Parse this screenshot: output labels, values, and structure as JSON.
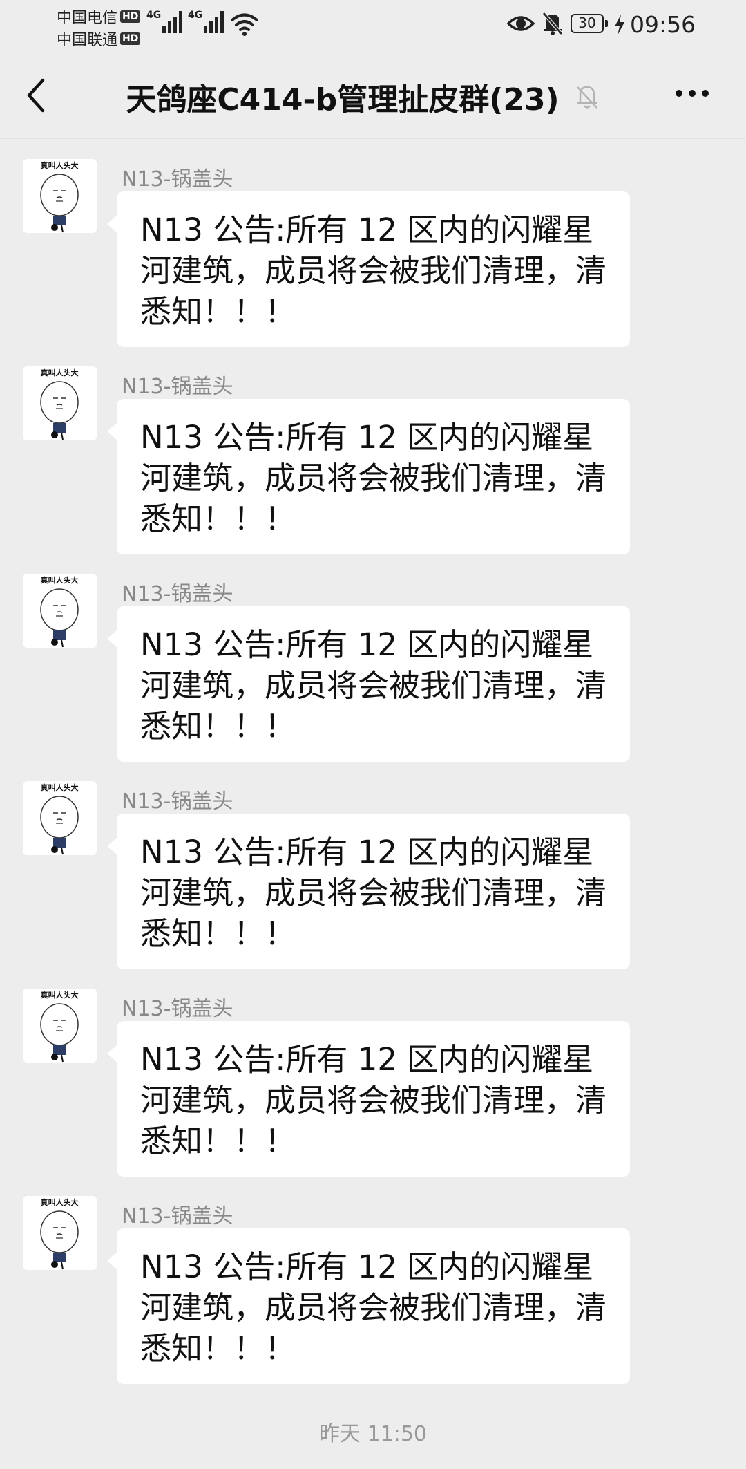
{
  "status_bar": {
    "carrier1": "中国电信",
    "carrier2": "中国联通",
    "hd1": "HD",
    "hd2": "HD",
    "net1": "4G",
    "net2": "4G",
    "battery": "30",
    "time": "09:56"
  },
  "nav": {
    "title": "天鸽座C414-b管理扯皮群(23)",
    "back_icon": "chevron-left-icon",
    "mute_icon": "bell-off-icon",
    "more_icon": "more-horizontal-icon"
  },
  "messages": [
    {
      "sender": "N13-锅盖头",
      "avatar_caption": "真叫人头大",
      "text": "N13 公告:所有 12 区内的闪耀星河建筑，成员将会被我们清理，清悉知！！！"
    },
    {
      "sender": "N13-锅盖头",
      "avatar_caption": "真叫人头大",
      "text": "N13 公告:所有 12 区内的闪耀星河建筑，成员将会被我们清理，清悉知！！！"
    },
    {
      "sender": "N13-锅盖头",
      "avatar_caption": "真叫人头大",
      "text": "N13 公告:所有 12 区内的闪耀星河建筑，成员将会被我们清理，清悉知！！！"
    },
    {
      "sender": "N13-锅盖头",
      "avatar_caption": "真叫人头大",
      "text": "N13 公告:所有 12 区内的闪耀星河建筑，成员将会被我们清理，清悉知！！！"
    },
    {
      "sender": "N13-锅盖头",
      "avatar_caption": "真叫人头大",
      "text": "N13 公告:所有 12 区内的闪耀星河建筑，成员将会被我们清理，清悉知！！！"
    },
    {
      "sender": "N13-锅盖头",
      "avatar_caption": "真叫人头大",
      "text": "N13 公告:所有 12 区内的闪耀星河建筑，成员将会被我们清理，清悉知！！！"
    }
  ],
  "timestamp": "昨天 11:50"
}
